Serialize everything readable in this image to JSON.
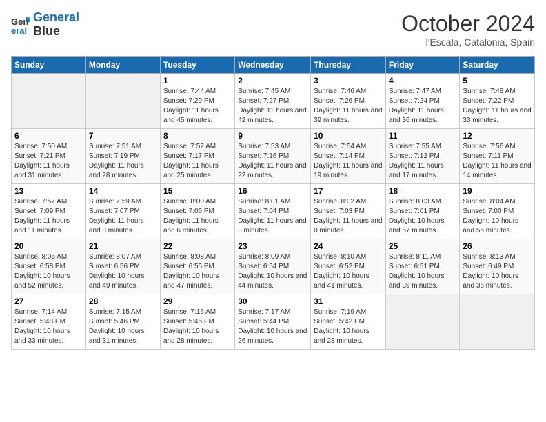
{
  "header": {
    "logo": {
      "line1": "General",
      "line2": "Blue"
    },
    "title": "October 2024",
    "subtitle": "l'Escala, Catalonia, Spain"
  },
  "days_of_week": [
    "Sunday",
    "Monday",
    "Tuesday",
    "Wednesday",
    "Thursday",
    "Friday",
    "Saturday"
  ],
  "weeks": [
    [
      {
        "num": "",
        "info": ""
      },
      {
        "num": "",
        "info": ""
      },
      {
        "num": "1",
        "info": "Sunrise: 7:44 AM\nSunset: 7:29 PM\nDaylight: 11 hours and 45 minutes."
      },
      {
        "num": "2",
        "info": "Sunrise: 7:45 AM\nSunset: 7:27 PM\nDaylight: 11 hours and 42 minutes."
      },
      {
        "num": "3",
        "info": "Sunrise: 7:46 AM\nSunset: 7:26 PM\nDaylight: 11 hours and 39 minutes."
      },
      {
        "num": "4",
        "info": "Sunrise: 7:47 AM\nSunset: 7:24 PM\nDaylight: 11 hours and 36 minutes."
      },
      {
        "num": "5",
        "info": "Sunrise: 7:48 AM\nSunset: 7:22 PM\nDaylight: 11 hours and 33 minutes."
      }
    ],
    [
      {
        "num": "6",
        "info": "Sunrise: 7:50 AM\nSunset: 7:21 PM\nDaylight: 11 hours and 31 minutes."
      },
      {
        "num": "7",
        "info": "Sunrise: 7:51 AM\nSunset: 7:19 PM\nDaylight: 11 hours and 28 minutes."
      },
      {
        "num": "8",
        "info": "Sunrise: 7:52 AM\nSunset: 7:17 PM\nDaylight: 11 hours and 25 minutes."
      },
      {
        "num": "9",
        "info": "Sunrise: 7:53 AM\nSunset: 7:16 PM\nDaylight: 11 hours and 22 minutes."
      },
      {
        "num": "10",
        "info": "Sunrise: 7:54 AM\nSunset: 7:14 PM\nDaylight: 11 hours and 19 minutes."
      },
      {
        "num": "11",
        "info": "Sunrise: 7:55 AM\nSunset: 7:12 PM\nDaylight: 11 hours and 17 minutes."
      },
      {
        "num": "12",
        "info": "Sunrise: 7:56 AM\nSunset: 7:11 PM\nDaylight: 11 hours and 14 minutes."
      }
    ],
    [
      {
        "num": "13",
        "info": "Sunrise: 7:57 AM\nSunset: 7:09 PM\nDaylight: 11 hours and 11 minutes."
      },
      {
        "num": "14",
        "info": "Sunrise: 7:59 AM\nSunset: 7:07 PM\nDaylight: 11 hours and 8 minutes."
      },
      {
        "num": "15",
        "info": "Sunrise: 8:00 AM\nSunset: 7:06 PM\nDaylight: 11 hours and 6 minutes."
      },
      {
        "num": "16",
        "info": "Sunrise: 8:01 AM\nSunset: 7:04 PM\nDaylight: 11 hours and 3 minutes."
      },
      {
        "num": "17",
        "info": "Sunrise: 8:02 AM\nSunset: 7:03 PM\nDaylight: 11 hours and 0 minutes."
      },
      {
        "num": "18",
        "info": "Sunrise: 8:03 AM\nSunset: 7:01 PM\nDaylight: 10 hours and 57 minutes."
      },
      {
        "num": "19",
        "info": "Sunrise: 8:04 AM\nSunset: 7:00 PM\nDaylight: 10 hours and 55 minutes."
      }
    ],
    [
      {
        "num": "20",
        "info": "Sunrise: 8:05 AM\nSunset: 6:58 PM\nDaylight: 10 hours and 52 minutes."
      },
      {
        "num": "21",
        "info": "Sunrise: 8:07 AM\nSunset: 6:56 PM\nDaylight: 10 hours and 49 minutes."
      },
      {
        "num": "22",
        "info": "Sunrise: 8:08 AM\nSunset: 6:55 PM\nDaylight: 10 hours and 47 minutes."
      },
      {
        "num": "23",
        "info": "Sunrise: 8:09 AM\nSunset: 6:54 PM\nDaylight: 10 hours and 44 minutes."
      },
      {
        "num": "24",
        "info": "Sunrise: 8:10 AM\nSunset: 6:52 PM\nDaylight: 10 hours and 41 minutes."
      },
      {
        "num": "25",
        "info": "Sunrise: 8:11 AM\nSunset: 6:51 PM\nDaylight: 10 hours and 39 minutes."
      },
      {
        "num": "26",
        "info": "Sunrise: 8:13 AM\nSunset: 6:49 PM\nDaylight: 10 hours and 36 minutes."
      }
    ],
    [
      {
        "num": "27",
        "info": "Sunrise: 7:14 AM\nSunset: 5:48 PM\nDaylight: 10 hours and 33 minutes."
      },
      {
        "num": "28",
        "info": "Sunrise: 7:15 AM\nSunset: 5:46 PM\nDaylight: 10 hours and 31 minutes."
      },
      {
        "num": "29",
        "info": "Sunrise: 7:16 AM\nSunset: 5:45 PM\nDaylight: 10 hours and 28 minutes."
      },
      {
        "num": "30",
        "info": "Sunrise: 7:17 AM\nSunset: 5:44 PM\nDaylight: 10 hours and 26 minutes."
      },
      {
        "num": "31",
        "info": "Sunrise: 7:19 AM\nSunset: 5:42 PM\nDaylight: 10 hours and 23 minutes."
      },
      {
        "num": "",
        "info": ""
      },
      {
        "num": "",
        "info": ""
      }
    ]
  ]
}
